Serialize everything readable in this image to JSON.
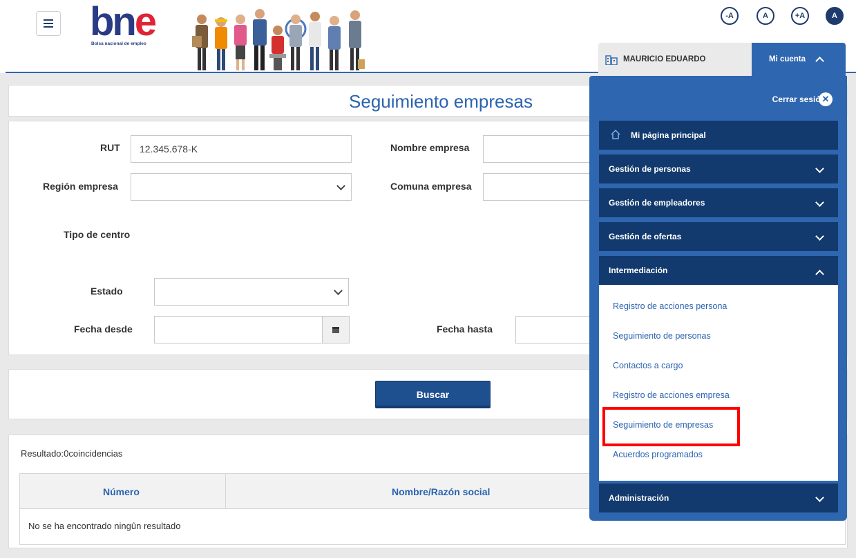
{
  "header": {
    "logo_text": "bne",
    "logo_subtitle": "Bolsa nacional de empleo",
    "accessibility": [
      "-A",
      "A",
      "+A",
      "A"
    ]
  },
  "user_tab": {
    "name": "MAURICIO EDUARDO"
  },
  "account_tab": {
    "label": "Mi cuenta"
  },
  "account_menu": {
    "logout": "Cerrar sesión",
    "logout_icon": "close-icon",
    "home": "Mi página principal",
    "sections": [
      "Gestión de personas",
      "Gestión de empleadores",
      "Gestión de ofertas",
      "Intermediación",
      "Administración"
    ],
    "intermediacion_items": [
      "Registro de acciones persona",
      "Seguimiento de personas",
      "Contactos a cargo",
      "Registro de acciones empresa",
      "Seguimiento de empresas",
      "Acuerdos programados"
    ]
  },
  "page": {
    "title": "Seguimiento empresas"
  },
  "form": {
    "rut_label": "RUT",
    "rut_value": "12.345.678-K",
    "nombre_empresa_label": "Nombre empresa",
    "region_label": "Región empresa",
    "comuna_label": "Comuna empresa",
    "tipo_centro_label": "Tipo de centro",
    "estado_label": "Estado",
    "fecha_desde_label": "Fecha desde",
    "fecha_hasta_label": "Fecha hasta"
  },
  "search": {
    "button": "Buscar"
  },
  "results": {
    "summary": "Resultado:0coincidencias",
    "columns": [
      "Número",
      "Nombre/Razón social"
    ],
    "empty_message": "No se ha encontrado ningûn resultado"
  }
}
